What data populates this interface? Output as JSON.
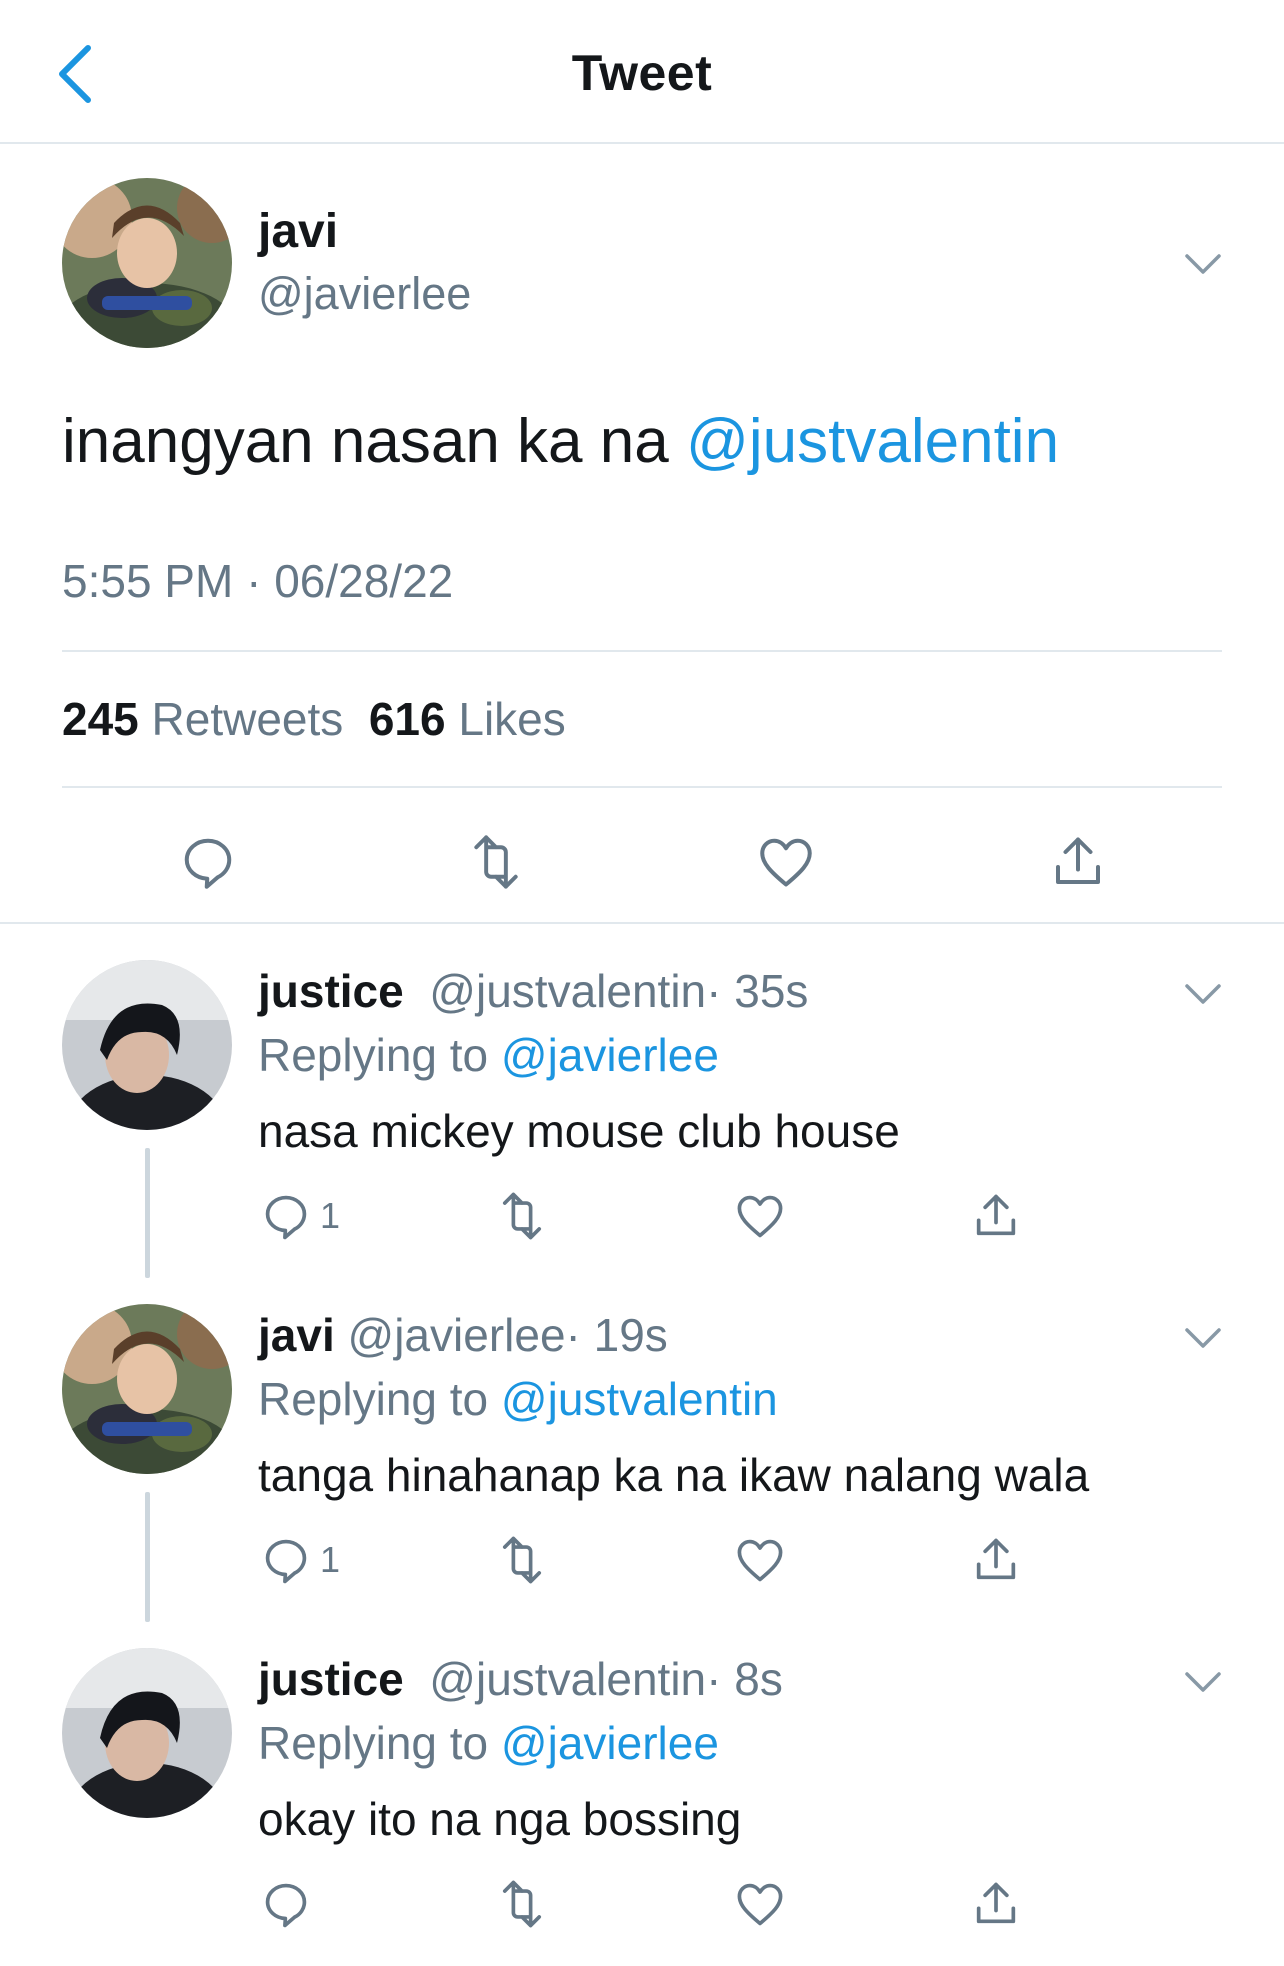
{
  "header": {
    "title": "Tweet",
    "back_icon": "chevron-left-icon"
  },
  "colors": {
    "link": "#1b95e0",
    "secondary_text": "#657786",
    "divider": "#e1e8ed",
    "thread_line": "#ccd6dd",
    "icon": "#657786"
  },
  "main_tweet": {
    "name": "javi",
    "handle": "@javierlee",
    "text": "inangyan nasan ka na ",
    "mention": "@justvalentin",
    "timestamp": "5:55 PM · 06/28/22",
    "stats": {
      "retweets_count": "245",
      "retweets_label": "Retweets",
      "likes_count": "616",
      "likes_label": "Likes"
    },
    "actions": [
      "reply-icon",
      "retweet-icon",
      "like-icon",
      "share-icon"
    ]
  },
  "replies": [
    {
      "name": "justice",
      "handle": "@justvalentin",
      "time": "· 35s",
      "replying_label": "Replying to ",
      "replying_to": "@javierlee",
      "text": "nasa mickey mouse club house",
      "reply_count": "1"
    },
    {
      "name": "javi",
      "handle": "@javierlee",
      "time": "· 19s",
      "replying_label": "Replying to ",
      "replying_to": "@justvalentin",
      "text": "tanga hinahanap ka na ikaw nalang wala",
      "reply_count": "1"
    },
    {
      "name": "justice",
      "handle": "@justvalentin",
      "time": "· 8s",
      "replying_label": "Replying to ",
      "replying_to": "@javierlee",
      "text": "okay ito na nga bossing",
      "reply_count": ""
    }
  ]
}
